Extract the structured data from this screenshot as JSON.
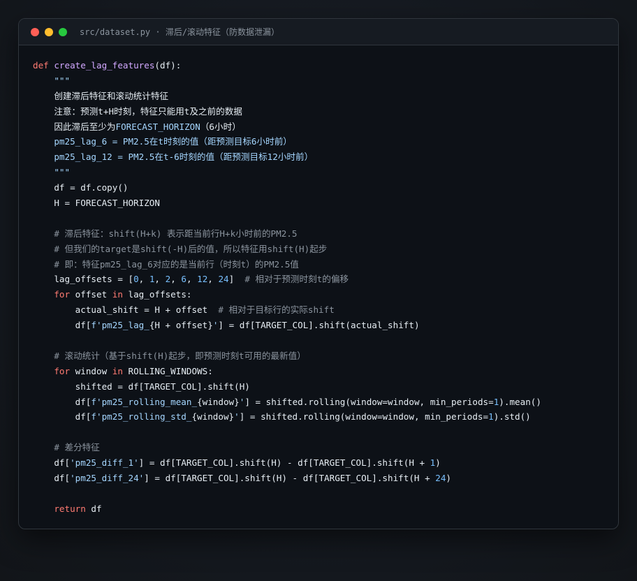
{
  "window": {
    "title": "src/dataset.py · 滞后/滚动特征（防数据泄漏）"
  },
  "code_lines": [
    [
      [
        "kw",
        "def "
      ],
      [
        "fn",
        "create_lag_features"
      ],
      [
        "plain",
        "(df):"
      ]
    ],
    [
      [
        "doc",
        "    \"\"\""
      ]
    ],
    [
      [
        "plain",
        "    创建滞后特征和滚动统计特征"
      ]
    ],
    [
      [
        "plain",
        "    注意：预测t+H时刻，特征只能用t及之前的数据"
      ]
    ],
    [
      [
        "plain",
        "    因此滞后至少为"
      ],
      [
        "str",
        "FORECAST_HORIZON"
      ],
      [
        "plain",
        "（6小时）"
      ]
    ],
    [
      [
        "str",
        "    pm25_lag_6 = PM2.5在t时刻的值（距预测目标6小时前）"
      ]
    ],
    [
      [
        "str",
        "    pm25_lag_12 = PM2.5在t-6时刻的值（距预测目标12小时前）"
      ]
    ],
    [
      [
        "doc",
        "    \"\"\""
      ]
    ],
    [
      [
        "plain",
        "    df = df.copy()"
      ]
    ],
    [
      [
        "plain",
        "    H = FORECAST_HORIZON"
      ]
    ],
    [
      [
        "plain",
        ""
      ]
    ],
    [
      [
        "com",
        "    # 滞后特征：shift(H+k) 表示距当前行H+k小时前的PM2.5"
      ]
    ],
    [
      [
        "com",
        "    # 但我们的target是shift(-H)后的值，所以特征用shift(H)起步"
      ]
    ],
    [
      [
        "com",
        "    # 即：特征pm25_lag_6对应的是当前行（时刻t）的PM2.5值"
      ]
    ],
    [
      [
        "plain",
        "    lag_offsets = ["
      ],
      [
        "num",
        "0"
      ],
      [
        "plain",
        ", "
      ],
      [
        "num",
        "1"
      ],
      [
        "plain",
        ", "
      ],
      [
        "num",
        "2"
      ],
      [
        "plain",
        ", "
      ],
      [
        "num",
        "6"
      ],
      [
        "plain",
        ", "
      ],
      [
        "num",
        "12"
      ],
      [
        "plain",
        ", "
      ],
      [
        "num",
        "24"
      ],
      [
        "plain",
        "]  "
      ],
      [
        "com",
        "# 相对于预测时刻t的偏移"
      ]
    ],
    [
      [
        "kw",
        "    for"
      ],
      [
        "plain",
        " offset "
      ],
      [
        "kw",
        "in"
      ],
      [
        "plain",
        " lag_offsets:"
      ]
    ],
    [
      [
        "plain",
        "        actual_shift = H + offset  "
      ],
      [
        "com",
        "# 相对于目标行的实际shift"
      ]
    ],
    [
      [
        "plain",
        "        df["
      ],
      [
        "str",
        "f'pm25_lag_"
      ],
      [
        "plain",
        "{H + offset}"
      ],
      [
        "str",
        "'"
      ],
      [
        "plain",
        "] = df[TARGET_COL].shift(actual_shift)"
      ]
    ],
    [
      [
        "plain",
        ""
      ]
    ],
    [
      [
        "com",
        "    # 滚动统计（基于shift(H)起步，即预测时刻t可用的最新值）"
      ]
    ],
    [
      [
        "kw",
        "    for"
      ],
      [
        "plain",
        " window "
      ],
      [
        "kw",
        "in"
      ],
      [
        "plain",
        " ROLLING_WINDOWS:"
      ]
    ],
    [
      [
        "plain",
        "        shifted = df[TARGET_COL].shift(H)"
      ]
    ],
    [
      [
        "plain",
        "        df["
      ],
      [
        "str",
        "f'pm25_rolling_mean_"
      ],
      [
        "plain",
        "{window}"
      ],
      [
        "str",
        "'"
      ],
      [
        "plain",
        "] = shifted.rolling(window=window, min_periods="
      ],
      [
        "num",
        "1"
      ],
      [
        "plain",
        ").mean()"
      ]
    ],
    [
      [
        "plain",
        "        df["
      ],
      [
        "str",
        "f'pm25_rolling_std_"
      ],
      [
        "plain",
        "{window}"
      ],
      [
        "str",
        "'"
      ],
      [
        "plain",
        "] = shifted.rolling(window=window, min_periods="
      ],
      [
        "num",
        "1"
      ],
      [
        "plain",
        ").std()"
      ]
    ],
    [
      [
        "plain",
        ""
      ]
    ],
    [
      [
        "com",
        "    # 差分特征"
      ]
    ],
    [
      [
        "plain",
        "    df["
      ],
      [
        "str",
        "'pm25_diff_1'"
      ],
      [
        "plain",
        "] = df[TARGET_COL].shift(H) - df[TARGET_COL].shift(H + "
      ],
      [
        "num",
        "1"
      ],
      [
        "plain",
        ")"
      ]
    ],
    [
      [
        "plain",
        "    df["
      ],
      [
        "str",
        "'pm25_diff_24'"
      ],
      [
        "plain",
        "] = df[TARGET_COL].shift(H) - df[TARGET_COL].shift(H + "
      ],
      [
        "num",
        "24"
      ],
      [
        "plain",
        ")"
      ]
    ],
    [
      [
        "plain",
        ""
      ]
    ],
    [
      [
        "kw",
        "    return"
      ],
      [
        "plain",
        " df"
      ]
    ]
  ],
  "colors": {
    "keyword": "#ff7b72",
    "function": "#d2a8ff",
    "string": "#a5d6ff",
    "number": "#79c0ff",
    "comment": "#8b949e",
    "text": "#e6edf3",
    "background": "#0d1117"
  }
}
